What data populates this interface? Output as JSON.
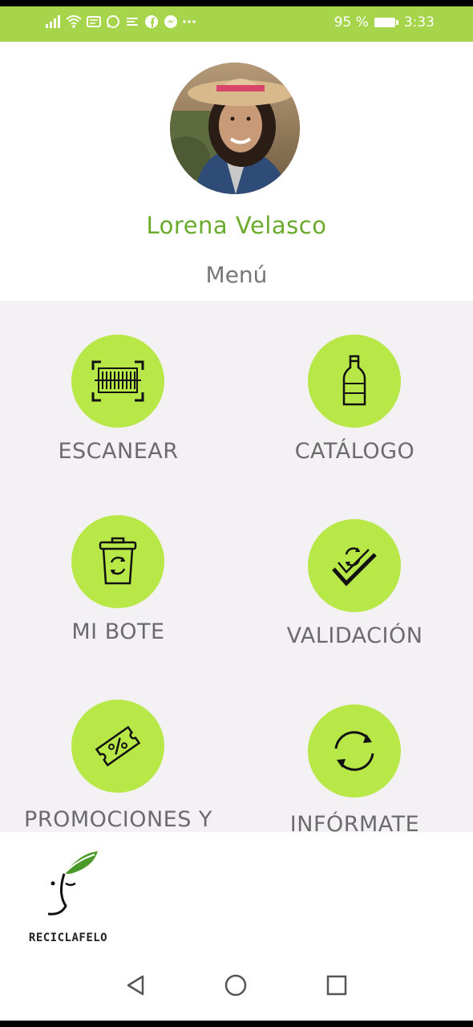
{
  "status_bar": {
    "battery": "95 %",
    "time": "3:33",
    "icons": [
      "signal-icon",
      "wifi-icon",
      "message-icon",
      "whatsapp-icon",
      "cast-icon",
      "facebook-icon",
      "messenger-icon",
      "more-icon"
    ]
  },
  "profile": {
    "name": "Lorena Velasco"
  },
  "menu": {
    "title": "Menú",
    "items": [
      {
        "label": "ESCANEAR",
        "icon": "barcode-scan-icon"
      },
      {
        "label": "CATÁLOGO",
        "icon": "bottle-icon"
      },
      {
        "label": "MI BOTE",
        "icon": "recycle-bin-icon"
      },
      {
        "label": "VALIDACIÓN",
        "icon": "check-recycle-icon"
      },
      {
        "label": "PROMOCIONES Y",
        "icon": "discount-ticket-icon"
      },
      {
        "label": "INFÓRMATE",
        "icon": "refresh-cycle-icon"
      }
    ]
  },
  "footer": {
    "logo_text": "RECICLAFELO"
  },
  "colors": {
    "accent": "#b8e848",
    "status_bar": "#a6d54b",
    "name_text": "#6aab2e",
    "grid_bg": "#f3f1f4"
  }
}
